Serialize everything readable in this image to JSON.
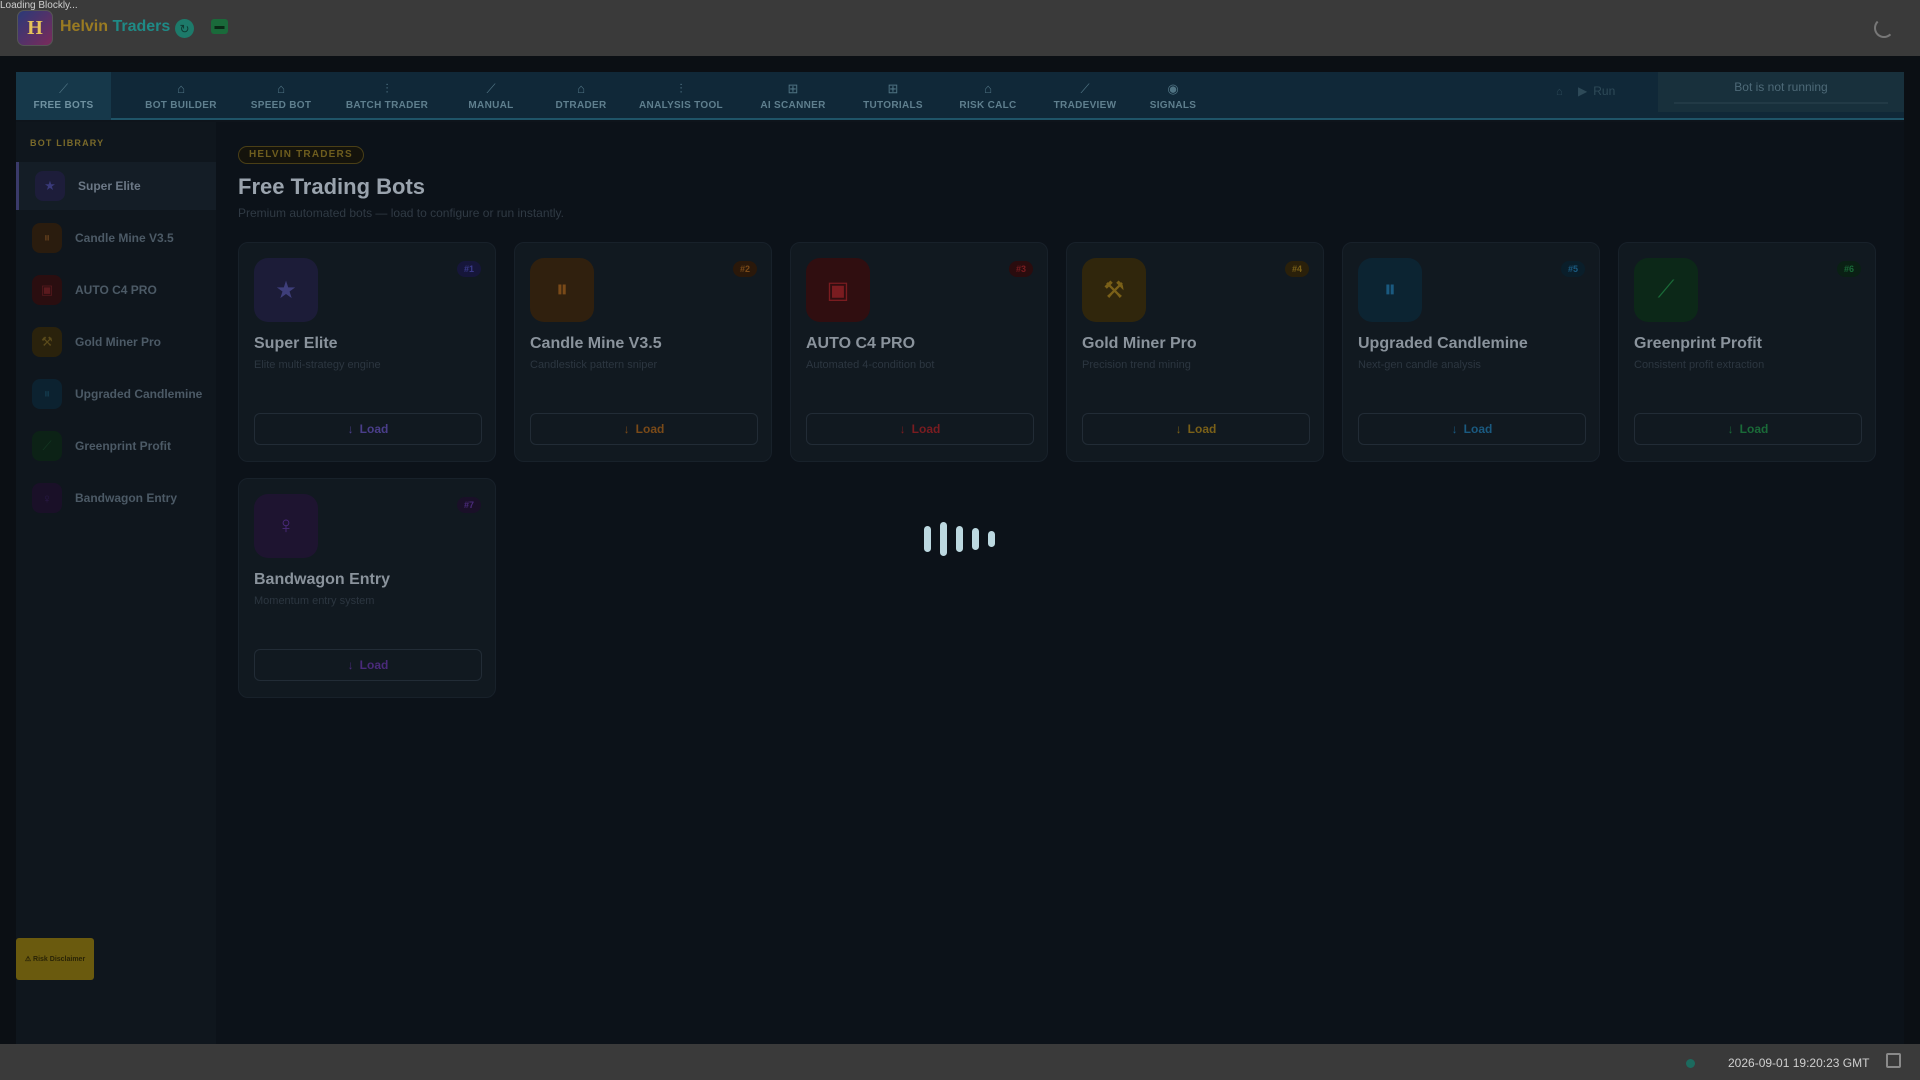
{
  "loading_text": "Loading Blockly...",
  "brand": {
    "logo_letter": "H",
    "name_part1": "Helvin",
    "name_part2": "Traders"
  },
  "tabs": [
    {
      "label": "FREE BOTS",
      "icon": "chart-line-icon",
      "glyph": "⟋"
    },
    {
      "label": "BOT BUILDER",
      "icon": "puzzle-icon",
      "glyph": "⌂"
    },
    {
      "label": "SPEED BOT",
      "icon": "puzzle-icon",
      "glyph": "⌂"
    },
    {
      "label": "BATCH TRADER",
      "icon": "sliders-icon",
      "glyph": "⫶"
    },
    {
      "label": "MANUAL",
      "icon": "chart-line-icon",
      "glyph": "⟋"
    },
    {
      "label": "DTRADER",
      "icon": "puzzle-icon",
      "glyph": "⌂"
    },
    {
      "label": "ANALYSIS TOOL",
      "icon": "sliders-icon",
      "glyph": "⫶"
    },
    {
      "label": "AI SCANNER",
      "icon": "grid-icon",
      "glyph": "⊞"
    },
    {
      "label": "TUTORIALS",
      "icon": "grid-icon",
      "glyph": "⊞"
    },
    {
      "label": "RISK CALC",
      "icon": "puzzle-icon",
      "glyph": "⌂"
    },
    {
      "label": "TRADEVIEW",
      "icon": "chart-line-icon",
      "glyph": "⟋"
    },
    {
      "label": "SIGNALS",
      "icon": "radio-signal-icon",
      "glyph": "◉"
    }
  ],
  "run": {
    "label": "Run"
  },
  "bot_status": "Bot is not running",
  "sidebar": {
    "title": "BOT LIBRARY",
    "items": [
      {
        "label": "Super Elite",
        "glyph": "★",
        "color": "#3a3a7a"
      },
      {
        "label": "Candle Mine V3.5",
        "glyph": "⏸",
        "color": "#5a3a1a"
      },
      {
        "label": "AUTO C4 PRO",
        "glyph": "▣",
        "color": "#5a1a1e"
      },
      {
        "label": "Gold Miner Pro",
        "glyph": "⚒",
        "color": "#5a4a1a"
      },
      {
        "label": "Upgraded Candlemine",
        "glyph": "⏸",
        "color": "#12384a"
      },
      {
        "label": "Greenprint Profit",
        "glyph": "⟋",
        "color": "#143a24"
      },
      {
        "label": "Bandwagon Entry",
        "glyph": "♀",
        "color": "#2a1a48"
      }
    ],
    "risk_button": "⚠ Risk Disclaimer"
  },
  "main": {
    "badge": "HELVIN TRADERS",
    "title": "Free Trading Bots",
    "subtitle": "Premium automated bots — load to configure or run instantly."
  },
  "cards": [
    {
      "num": "#1",
      "name": "Super Elite",
      "desc": "Elite multi-strategy engine",
      "load": "Load",
      "glyph": "★",
      "bg": "#2a2a55",
      "fg": "#5a5ab0",
      "accent": "#5a4ab0"
    },
    {
      "num": "#2",
      "name": "Candle Mine V3.5",
      "desc": "Candlestick pattern sniper",
      "load": "Load",
      "glyph": "⏸",
      "bg": "#4a2a12",
      "fg": "#c06a20",
      "accent": "#b0601c"
    },
    {
      "num": "#3",
      "name": "AUTO C4 PRO",
      "desc": "Automated 4-condition bot",
      "load": "Load",
      "glyph": "▣",
      "bg": "#4a1416",
      "fg": "#b02a30",
      "accent": "#a02a2e"
    },
    {
      "num": "#4",
      "name": "Gold Miner Pro",
      "desc": "Precision trend mining",
      "load": "Load",
      "glyph": "⚒",
      "bg": "#4a3a10",
      "fg": "#b08a20",
      "accent": "#a07a1c"
    },
    {
      "num": "#5",
      "name": "Upgraded Candlemine",
      "desc": "Next-gen candle analysis",
      "load": "Load",
      "glyph": "⏸",
      "bg": "#0f3246",
      "fg": "#2a7ab0",
      "accent": "#2a6a9a"
    },
    {
      "num": "#6",
      "name": "Greenprint Profit",
      "desc": "Consistent profit extraction",
      "load": "Load",
      "glyph": "⟋",
      "bg": "#123620",
      "fg": "#2a9a50",
      "accent": "#227a40"
    },
    {
      "num": "#7",
      "name": "Bandwagon Entry",
      "desc": "Momentum entry system",
      "load": "Load",
      "glyph": "♀",
      "bg": "#26183e",
      "fg": "#6a3ab0",
      "accent": "#5a3a9a"
    }
  ],
  "footer": {
    "time": "2026-09-01 19:20:23 GMT"
  }
}
